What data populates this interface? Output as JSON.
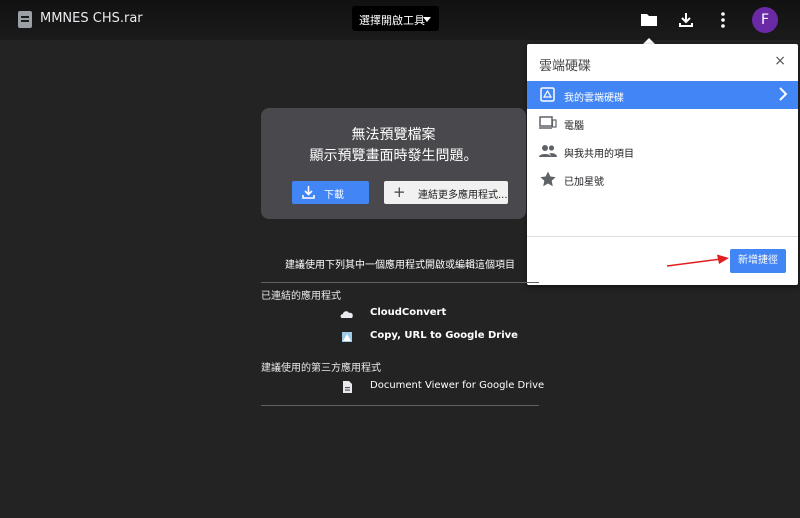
{
  "topbar": {
    "file_name": "MMNES CHS.rar",
    "open_with_label": "選擇開啟工具",
    "avatar_letter": "F",
    "avatar_color": "#6a2aa6",
    "icons": [
      "file-icon",
      "folder-icon",
      "download-icon",
      "more-vert-icon"
    ]
  },
  "popup": {
    "title": "雲端硬碟",
    "close_label": "×",
    "items": [
      {
        "label": "我的雲端硬碟",
        "icon": "drive-icon",
        "selected": true
      },
      {
        "label": "電腦",
        "icon": "computer-icon",
        "selected": false
      },
      {
        "label": "與我共用的項目",
        "icon": "people-icon",
        "selected": false
      },
      {
        "label": "已加星號",
        "icon": "star-icon",
        "selected": false
      }
    ],
    "add_shortcut_label": "新增捷徑",
    "accent_color": "#4285f4"
  },
  "error": {
    "line1": "無法預覽檔案",
    "line2": "顯示預覽畫面時發生問題。",
    "download_label": "下載",
    "connect_label": "連結更多應用程式..."
  },
  "suggestions": {
    "heading": "建議使用下列其中一個應用程式開啟或編輯這個項目",
    "connected_title": "已連結的應用程式",
    "connected_apps": [
      "CloudConvert",
      "Copy, URL to Google Drive"
    ],
    "third_party_title": "建議使用的第三方應用程式",
    "third_party_apps": [
      "Document Viewer for Google Drive"
    ]
  }
}
